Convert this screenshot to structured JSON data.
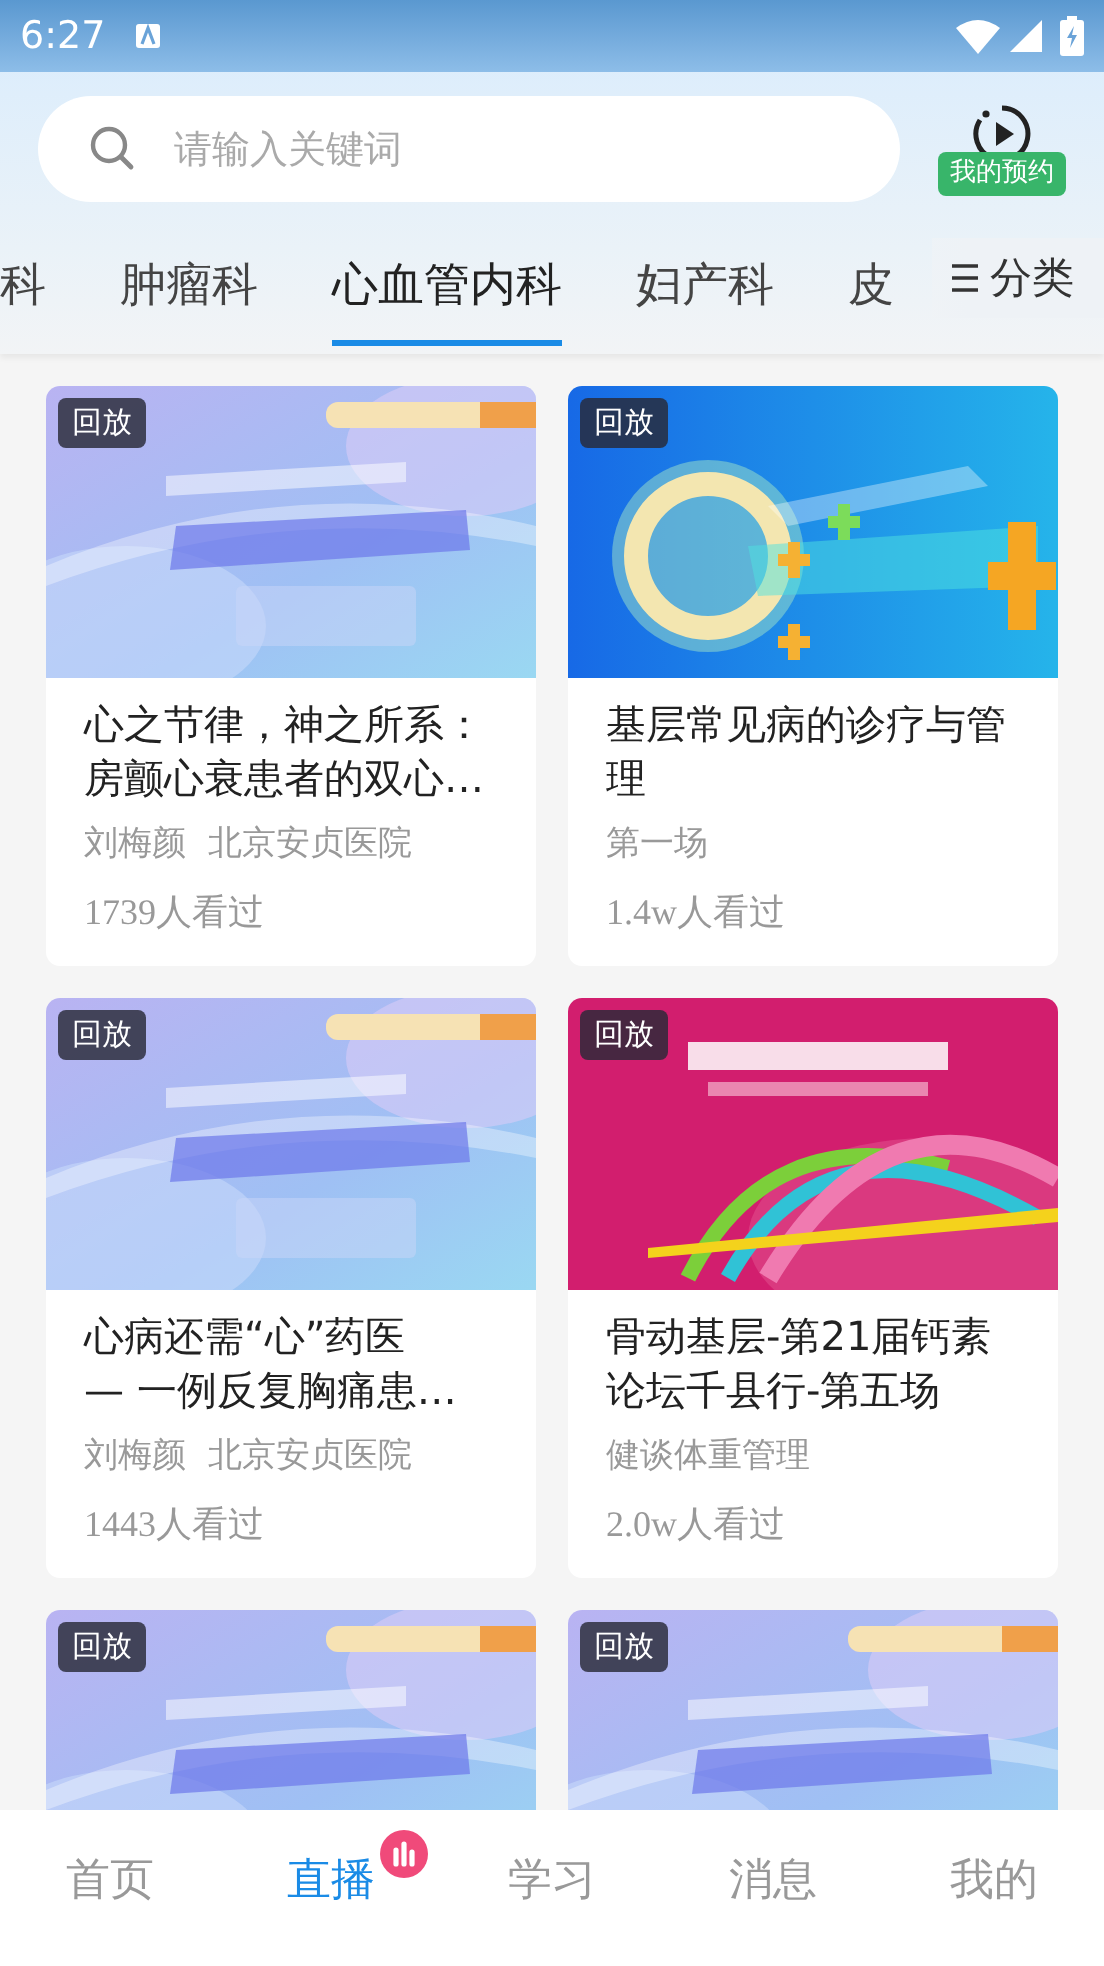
{
  "status_bar": {
    "time": "6:27"
  },
  "search": {
    "placeholder": "请输入关键词"
  },
  "reservation": {
    "label": "我的预约"
  },
  "tabs": [
    {
      "label": "科",
      "selected": false
    },
    {
      "label": "肿瘤科",
      "selected": false
    },
    {
      "label": "心血管内科",
      "selected": true
    },
    {
      "label": "妇产科",
      "selected": false
    },
    {
      "label": "皮",
      "selected": false
    }
  ],
  "category_button": {
    "label": "分类"
  },
  "cards": [
    {
      "badge": "回放",
      "title": "心之节律，神之所系：房颤心衰患者的双心…",
      "subtitle": "刘梅颜  北京安贞医院",
      "views": "1739人看过"
    },
    {
      "badge": "回放",
      "title": "基层常见病的诊疗与管理",
      "subtitle": "第一场",
      "views": "1.4w人看过"
    },
    {
      "badge": "回放",
      "title": "心病还需“心”药医\n— 一例反复胸痛患…",
      "subtitle": "刘梅颜  北京安贞医院",
      "views": "1443人看过"
    },
    {
      "badge": "回放",
      "title": "骨动基层-第21届钙素论坛千县行-第五场",
      "subtitle": "健谈体重管理",
      "views": "2.0w人看过"
    },
    {
      "badge": "回放"
    },
    {
      "badge": "回放"
    }
  ],
  "nav": [
    {
      "label": "首页",
      "selected": false,
      "live": false
    },
    {
      "label": "直播",
      "selected": true,
      "live": true
    },
    {
      "label": "学习",
      "selected": false,
      "live": false
    },
    {
      "label": "消息",
      "selected": false,
      "live": false
    },
    {
      "label": "我的",
      "selected": false,
      "live": false
    }
  ]
}
